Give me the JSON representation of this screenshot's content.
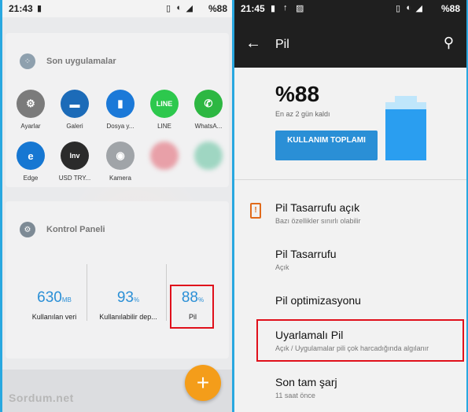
{
  "left": {
    "status": {
      "time": "21:43",
      "battery": "%88"
    },
    "recent_apps": {
      "title": "Son uygulamalar",
      "apps": [
        {
          "name": "Ayarlar",
          "color": "#7b7b7b",
          "glyph": "⚙"
        },
        {
          "name": "Galeri",
          "color": "#1c6bb8",
          "glyph": "▬"
        },
        {
          "name": "Dosya y...",
          "color": "#1b79d8",
          "glyph": "▮"
        },
        {
          "name": "LINE",
          "color": "#2dc84d",
          "glyph": "LINE"
        },
        {
          "name": "WhatsA...",
          "color": "#2db742",
          "glyph": "✆"
        },
        {
          "name": "Edge",
          "color": "#1677d2",
          "glyph": "e"
        },
        {
          "name": "USD TRY...",
          "color": "#2b2b2b",
          "glyph": "Inv"
        },
        {
          "name": "Kamera",
          "color": "#a0a4a8",
          "glyph": "◉"
        },
        {
          "name": "",
          "color": "#e8a0a8",
          "glyph": ""
        },
        {
          "name": "",
          "color": "#9fd6c2",
          "glyph": ""
        }
      ]
    },
    "control_panel": {
      "title": "Kontrol Paneli",
      "stats": [
        {
          "value": "630",
          "unit": "MB",
          "label": "Kullanılan veri"
        },
        {
          "value": "93",
          "unit": "%",
          "label": "Kullanılabilir dep..."
        },
        {
          "value": "88",
          "unit": "%",
          "label": "Pil"
        }
      ]
    },
    "fab": "+",
    "watermark": "Sordum.net"
  },
  "right": {
    "status": {
      "time": "21:45",
      "battery": "%88"
    },
    "appbar": {
      "title": "Pil",
      "back": "←",
      "search": "⚲"
    },
    "battery": {
      "percent_text": "%88",
      "level": 0.88,
      "remaining": "En az 2 gün kaldı",
      "usage_button": "KULLANIM TOPLAMI"
    },
    "rows": [
      {
        "title": "Pil Tasarrufu açık",
        "subtitle": "Bazı özellikler sınırlı olabilir"
      },
      {
        "title": "Pil Tasarrufu",
        "subtitle": "Açık"
      },
      {
        "title": "Pil optimizasyonu",
        "subtitle": ""
      },
      {
        "title": "Uyarlamalı Pil",
        "subtitle": "Açık / Uygulamalar pili çok harcadığında algılanır"
      },
      {
        "title": "Son tam şarj",
        "subtitle": "11 saat önce"
      }
    ],
    "accent": "#2a8fd6",
    "highlight": "#e0101b"
  }
}
